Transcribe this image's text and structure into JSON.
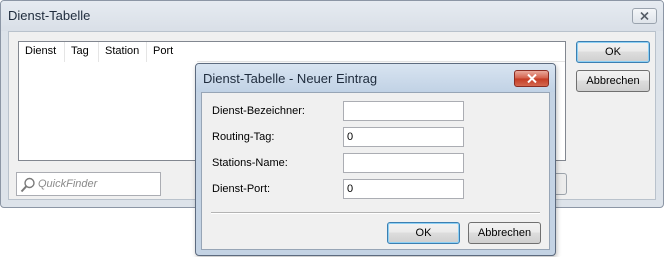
{
  "main": {
    "title": "Dienst-Tabelle",
    "close_icon": "close-icon",
    "columns": [
      "Dienst",
      "Tag",
      "Station",
      "Port"
    ],
    "quickfinder_placeholder": "QuickFinder",
    "search_icon": "magnifier-icon",
    "ok_label": "OK",
    "cancel_label": "Abbrechen"
  },
  "dialog": {
    "title": "Dienst-Tabelle - Neuer Eintrag",
    "close_icon": "close-icon",
    "close_color": "#c43b24",
    "fields": [
      {
        "label": "Dienst-Bezeichner:",
        "value": ""
      },
      {
        "label": "Routing-Tag:",
        "value": "0"
      },
      {
        "label": "Stations-Name:",
        "value": ""
      },
      {
        "label": "Dienst-Port:",
        "value": "0"
      }
    ],
    "ok_label": "OK",
    "cancel_label": "Abbrechen"
  }
}
